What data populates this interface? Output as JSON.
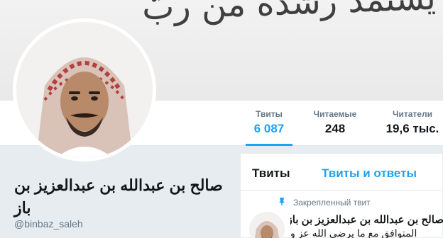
{
  "banner": {
    "script_text": "يستمد رشده من ربّ"
  },
  "stats": [
    {
      "label": "Твиты",
      "value": "6 087"
    },
    {
      "label": "Читаемые",
      "value": "248"
    },
    {
      "label": "Читатели",
      "value": "19,6 тыс."
    }
  ],
  "profile": {
    "name": "صالح بن عبدالله بن عبدالعزيز بن باز",
    "handle": "@binbaz_saleh"
  },
  "timeline": {
    "tabs": [
      {
        "label": "Твиты"
      },
      {
        "label": "Твиты и ответы"
      }
    ],
    "pinned_label": "Закрепленный твит",
    "tweet": {
      "author": "صالح بن عبدالله بن عبدالعزيز بن باز",
      "snippet": "المتوافق مع ما يرضي الله عز و"
    }
  },
  "colors": {
    "accent": "#1da1f2",
    "text": "#14171a",
    "muted": "#657786"
  },
  "icons": {
    "pin": "pin-icon"
  }
}
